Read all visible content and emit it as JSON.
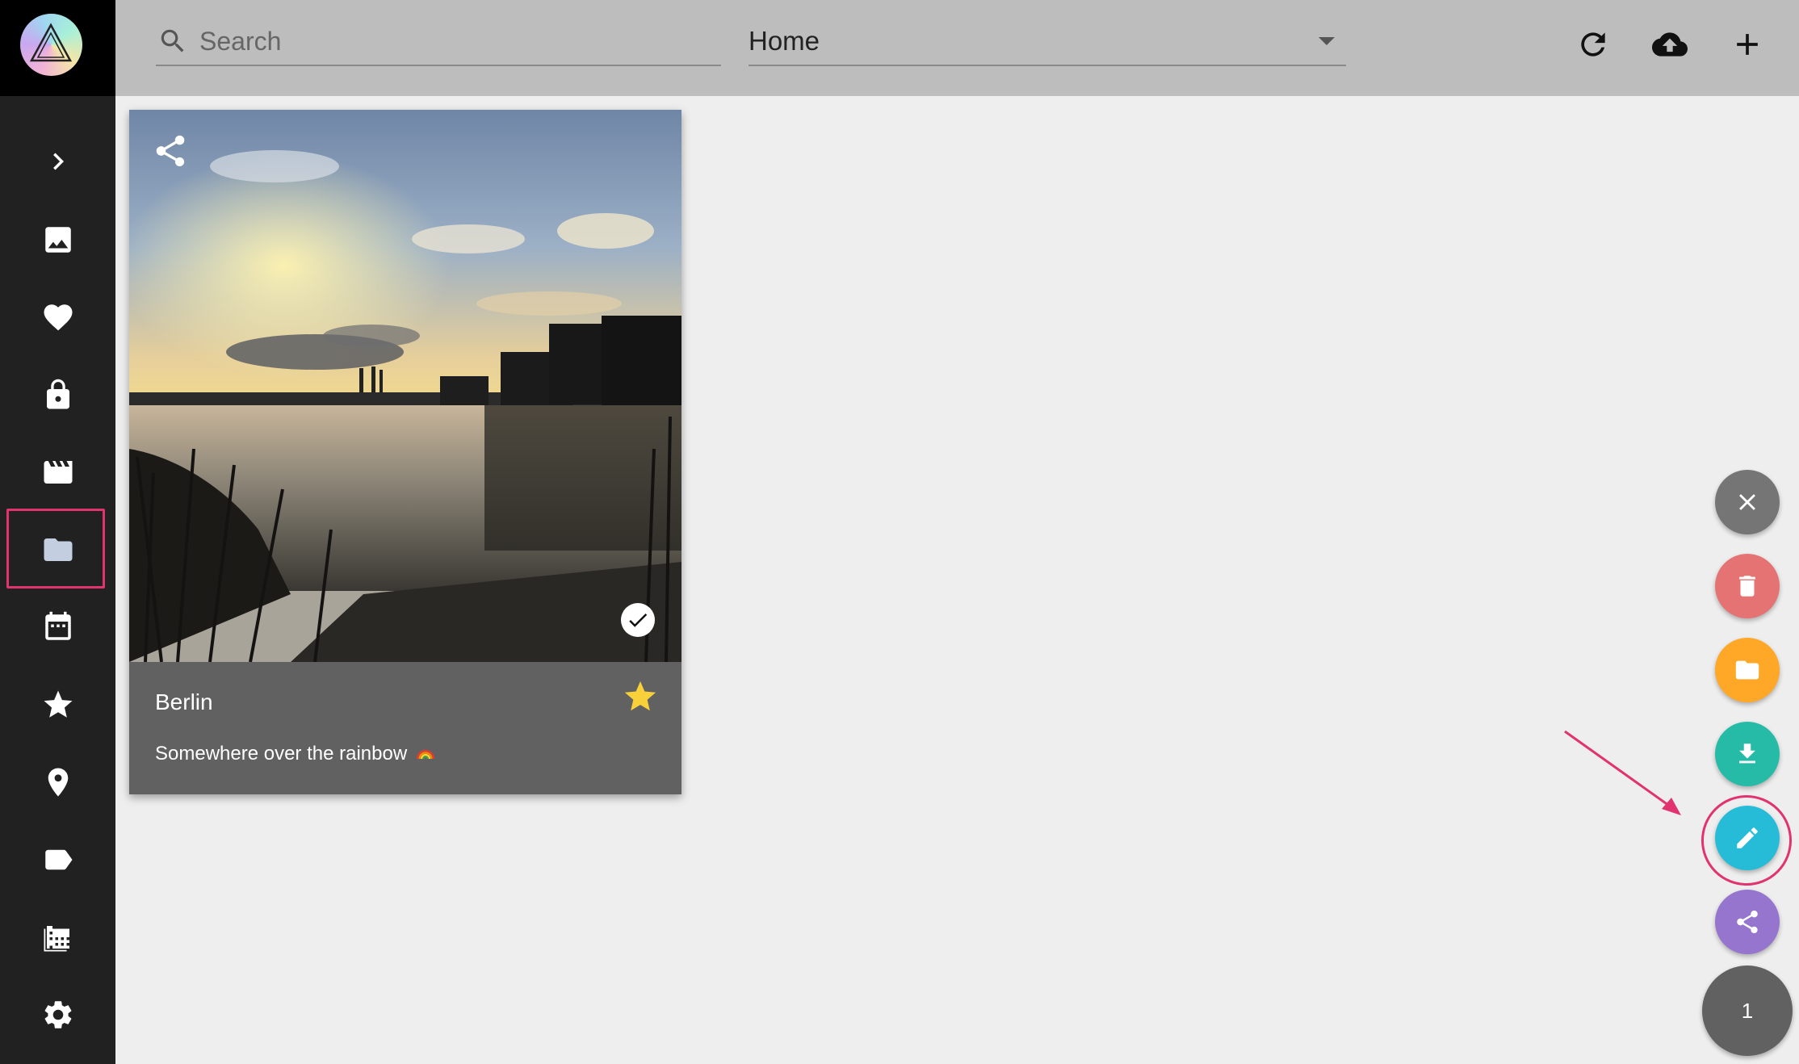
{
  "toolbar": {
    "search_placeholder": "Search",
    "album_select": "Home",
    "refresh_icon": "refresh-icon",
    "upload_icon": "cloud-upload-icon",
    "add_icon": "plus-icon"
  },
  "sidebar": {
    "items": [
      {
        "name": "expand",
        "icon": "chevron-right-icon"
      },
      {
        "name": "photos",
        "icon": "image-icon"
      },
      {
        "name": "favorites",
        "icon": "heart-icon"
      },
      {
        "name": "private",
        "icon": "lock-icon"
      },
      {
        "name": "videos",
        "icon": "movie-icon"
      },
      {
        "name": "folders",
        "icon": "folder-icon",
        "active": true
      },
      {
        "name": "calendar",
        "icon": "calendar-icon"
      },
      {
        "name": "moments",
        "icon": "star-icon"
      },
      {
        "name": "places",
        "icon": "location-pin-icon"
      },
      {
        "name": "labels",
        "icon": "label-icon"
      },
      {
        "name": "library",
        "icon": "film-library-icon"
      },
      {
        "name": "settings",
        "icon": "gear-icon"
      }
    ]
  },
  "card": {
    "title": "Berlin",
    "caption": "Somewhere over the rainbow",
    "favorite": true,
    "selected": true
  },
  "fabs": [
    {
      "name": "close",
      "icon": "close-icon",
      "color": "#757575"
    },
    {
      "name": "delete",
      "icon": "trash-icon",
      "color": "#e57373"
    },
    {
      "name": "album",
      "icon": "folder-icon",
      "color": "#ffa726"
    },
    {
      "name": "download",
      "icon": "download-icon",
      "color": "#26bba6"
    },
    {
      "name": "edit",
      "icon": "pencil-icon",
      "color": "#26bcd7"
    },
    {
      "name": "share",
      "icon": "share-icon",
      "color": "#9575cd"
    }
  ],
  "selection_count": "1",
  "colors": {
    "sidebar": "#212121",
    "toolbar": "#bdbdbd",
    "background": "#eeeeee",
    "highlight": "#e0336f"
  }
}
